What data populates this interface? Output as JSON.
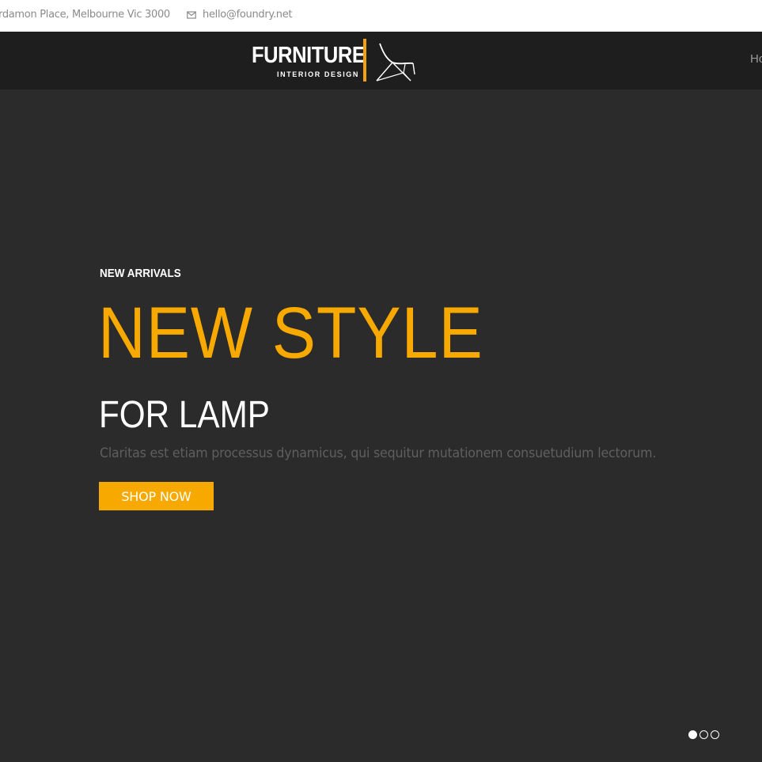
{
  "topbar": {
    "address": "rdamon Place, Melbourne Vic 3000",
    "email": "hello@foundry.net",
    "mail_icon": "envelope-icon"
  },
  "header": {
    "logo": {
      "brand": "FURNITURE",
      "tagline": "INTERIOR DESIGN",
      "icon": "chair-icon",
      "accent_color": "#f0a30a"
    },
    "nav_partial": "Ho"
  },
  "hero": {
    "kicker": "NEW ARRIVALS",
    "headline": "NEW STYLE",
    "subheadline": "FOR LAMP",
    "description": "Claritas est etiam processus dynamicus, qui sequitur mutationem consuetudium lectorum.",
    "cta_label": "SHOP NOW",
    "accent_color": "#f7a900",
    "slides_total": 3,
    "active_slide": 1
  }
}
